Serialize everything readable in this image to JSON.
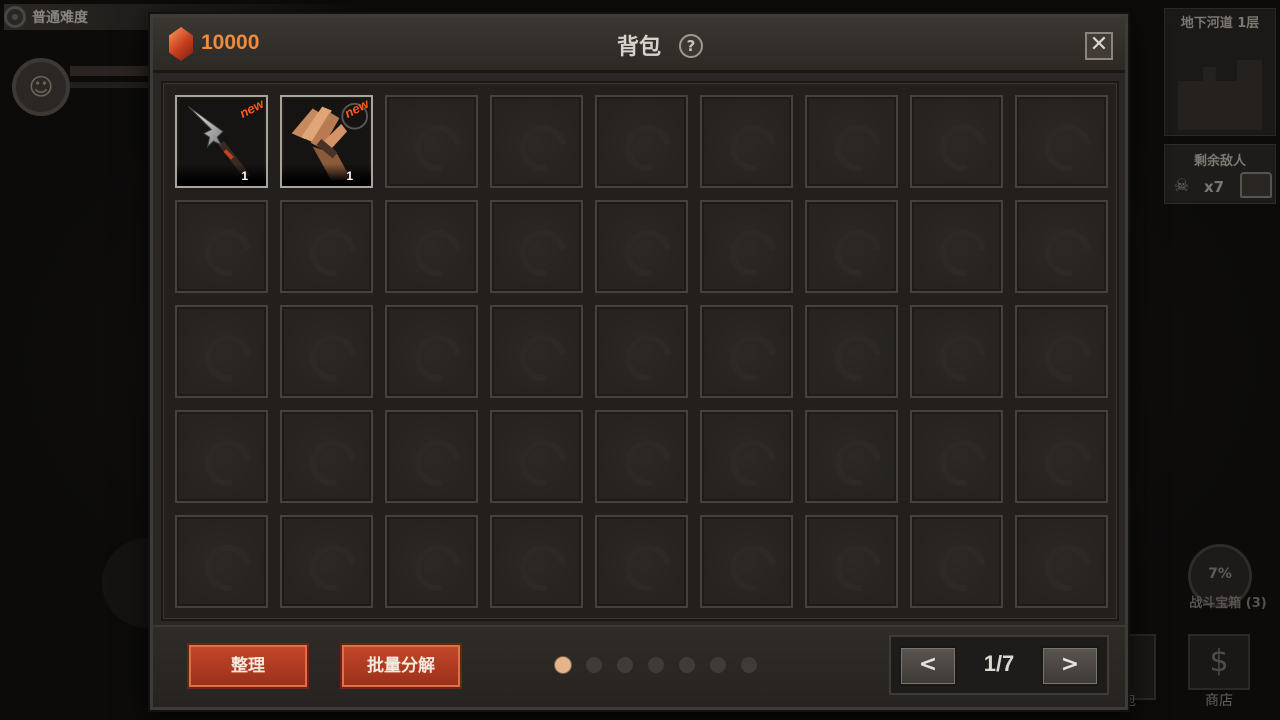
{
  "hud": {
    "difficulty": "普通难度",
    "floor": "地下河道 1层",
    "enemies_label": "剩余敌人",
    "enemies_count": "x7",
    "medal_percent": "7%",
    "medal_label": "战斗宝箱 (3)",
    "shop_label": "商店",
    "bag_label_partial": "包"
  },
  "bag": {
    "currency_amount": "10000",
    "title": "背包",
    "help_symbol": "?",
    "close_symbol": "✕",
    "items": [
      {
        "name": "spear-head",
        "badge": "new",
        "qty": "1"
      },
      {
        "name": "stake-bundle",
        "badge": "new",
        "qty": "1"
      }
    ],
    "empty_slots": 43,
    "buttons": {
      "sort": "整理",
      "batch_decompose": "批量分解"
    },
    "page_dots": 7,
    "current_dot": 1,
    "pagination": {
      "prev": "<",
      "next": ">",
      "text": "1/7"
    }
  }
}
